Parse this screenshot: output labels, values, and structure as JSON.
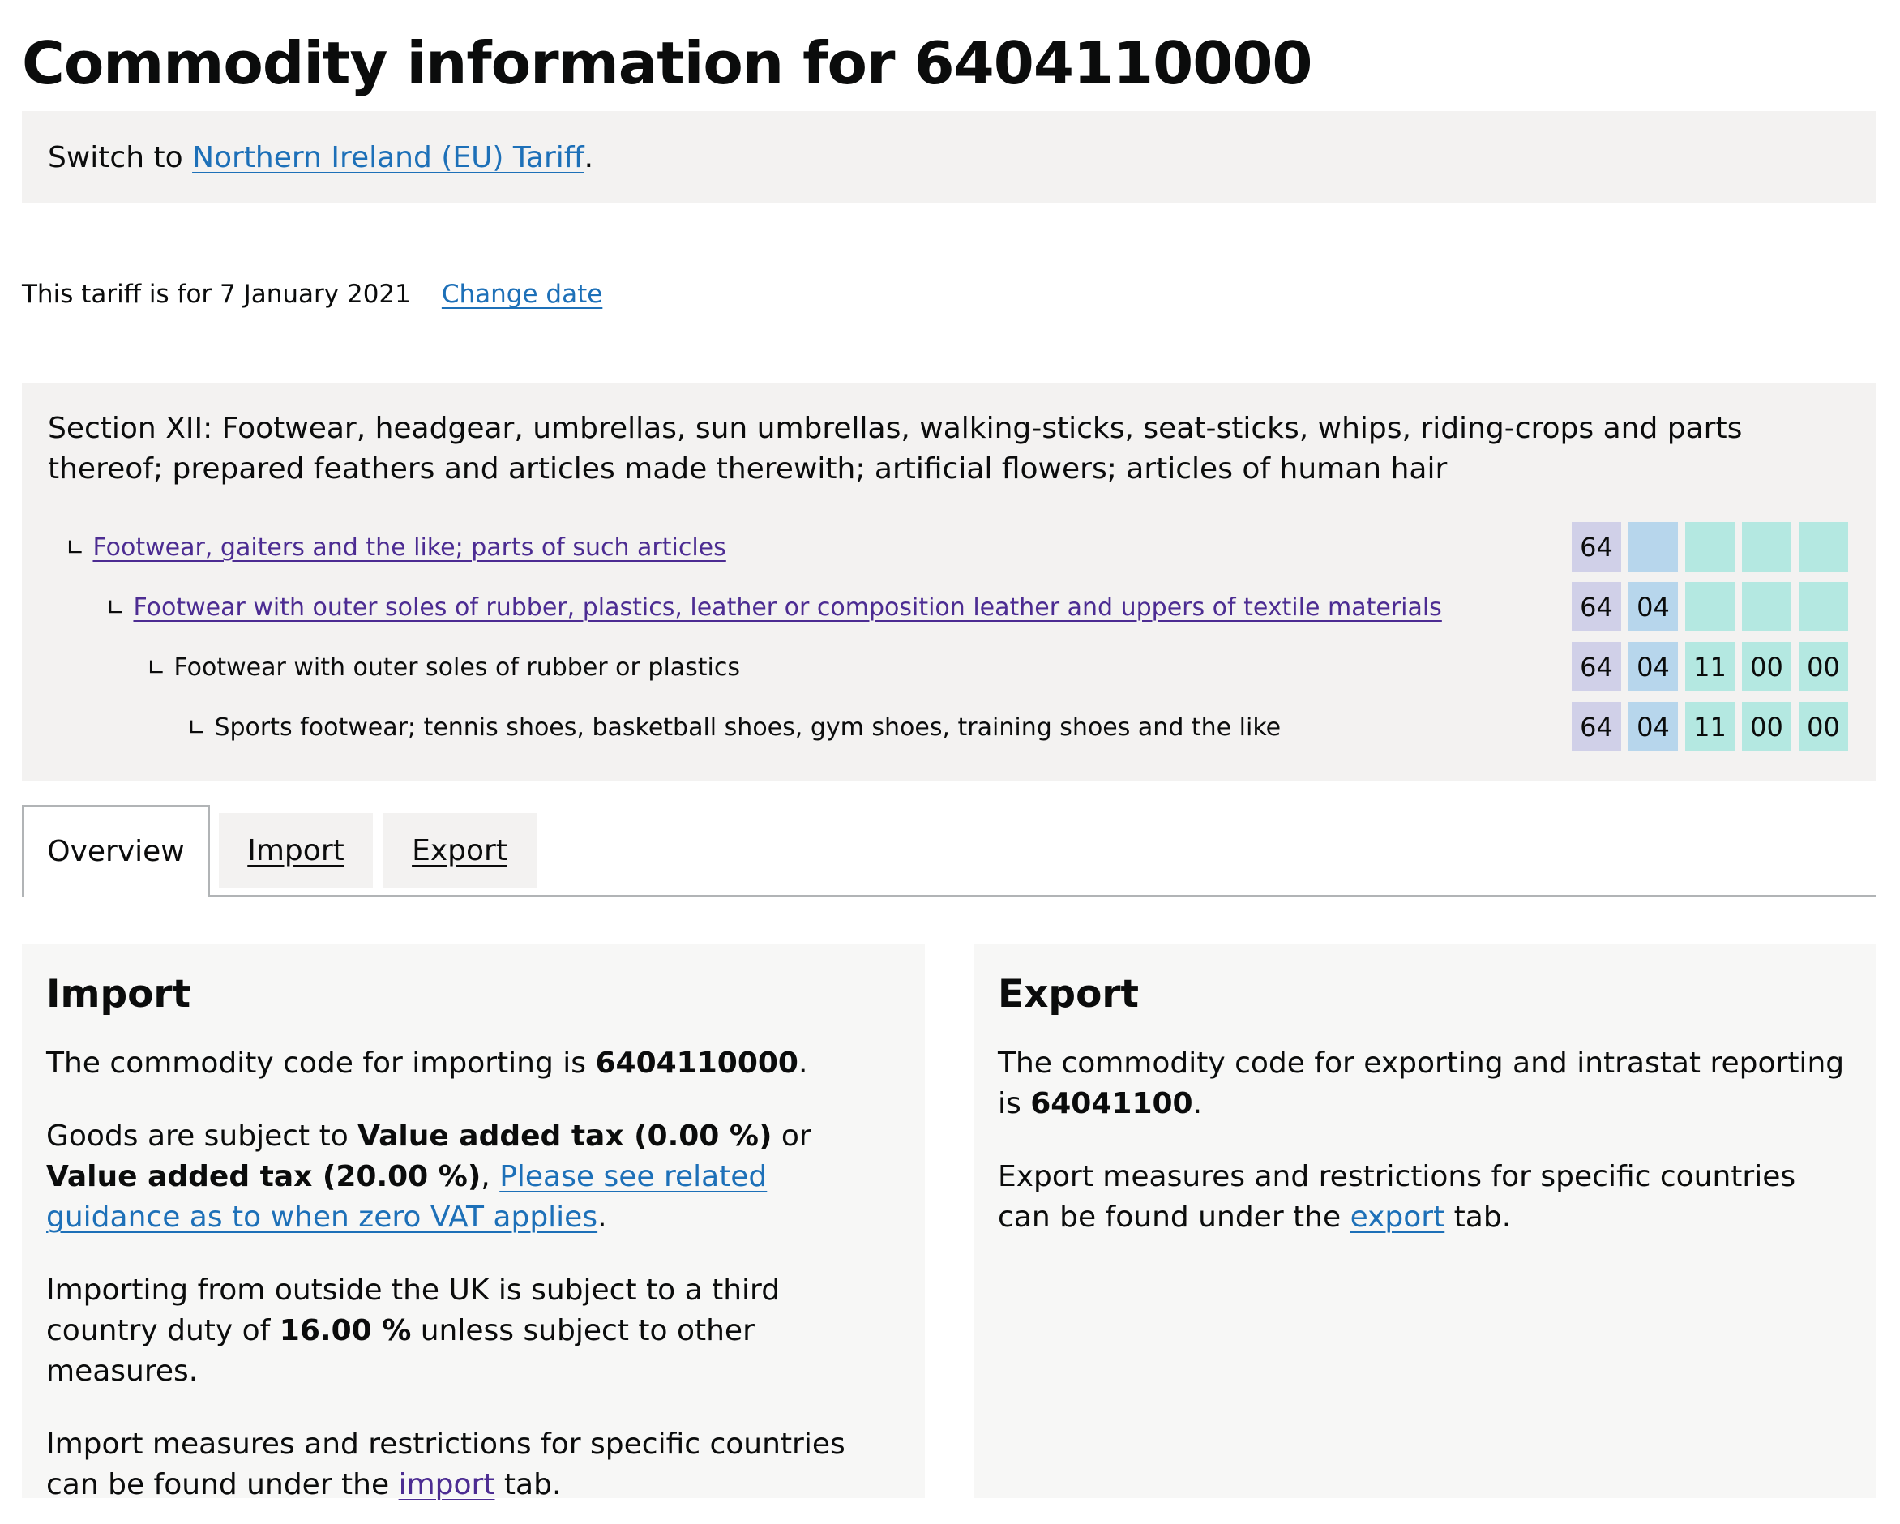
{
  "page": {
    "title": "Commodity information for 6404110000"
  },
  "switch_banner": {
    "prefix": "Switch to ",
    "link": "Northern Ireland (EU) Tariff",
    "suffix": "."
  },
  "date_bar": {
    "text": "This tariff is for 7 January 2021",
    "change_link": "Change date"
  },
  "breadcrumb": {
    "section": "Section XII: Footwear, headgear, umbrellas, sun umbrellas, walking-sticks, seat-sticks, whips, riding-crops and parts thereof; prepared feathers and articles made therewith; artificial flowers; articles of human hair",
    "corner_glyph": "∟",
    "rows": [
      {
        "label": "Footwear, gaiters and the like; parts of such articles",
        "is_link": true,
        "codes": [
          "64",
          "",
          "",
          "",
          ""
        ]
      },
      {
        "label": "Footwear with outer soles of rubber, plastics, leather or composition leather and uppers of textile materials",
        "is_link": true,
        "codes": [
          "64",
          "04",
          "",
          "",
          ""
        ]
      },
      {
        "label": "Footwear with outer soles of rubber or plastics",
        "is_link": false,
        "codes": [
          "64",
          "04",
          "11",
          "00",
          "00"
        ]
      },
      {
        "label": "Sports footwear; tennis shoes, basketball shoes, gym shoes, training shoes and the like",
        "is_link": false,
        "codes": [
          "64",
          "04",
          "11",
          "00",
          "00"
        ]
      }
    ]
  },
  "tabs": [
    {
      "label": "Overview",
      "selected": true
    },
    {
      "label": "Import",
      "selected": false
    },
    {
      "label": "Export",
      "selected": false
    }
  ],
  "import_panel": {
    "heading": "Import",
    "p1_prefix": "The commodity code for importing is ",
    "p1_code": "6404110000",
    "p1_suffix": ".",
    "p2_prefix": "Goods are subject to ",
    "p2_vat_zero": "Value added tax (0.00 %)",
    "p2_or": " or ",
    "p2_vat_std": "Value added tax (20.00 %)",
    "p2_comma": ", ",
    "p2_link": "Please see related guidance as to when zero VAT applies",
    "p2_suffix": ".",
    "p3_prefix": "Importing from outside the UK is subject to a third country duty of ",
    "p3_duty": "16.00 %",
    "p3_suffix": " unless subject to other measures.",
    "p4_prefix": "Import measures and restrictions for specific countries can be found under the ",
    "p4_link": "import",
    "p4_suffix": " tab."
  },
  "export_panel": {
    "heading": "Export",
    "p1_prefix": "The commodity code for exporting and intrastat reporting is ",
    "p1_code": "64041100",
    "p1_suffix": ".",
    "p2_prefix": "Export measures and restrictions for specific countries can be found under the ",
    "p2_link": "export",
    "p2_suffix": " tab."
  },
  "colors": {
    "link": "#1d70b8",
    "visited_link": "#4c2c92",
    "chapter_cell": "#d0d0e8",
    "heading_cell": "#b7d6ec",
    "subheading_cell": "#b4e8e1",
    "panel_bg": "#f3f2f1"
  }
}
